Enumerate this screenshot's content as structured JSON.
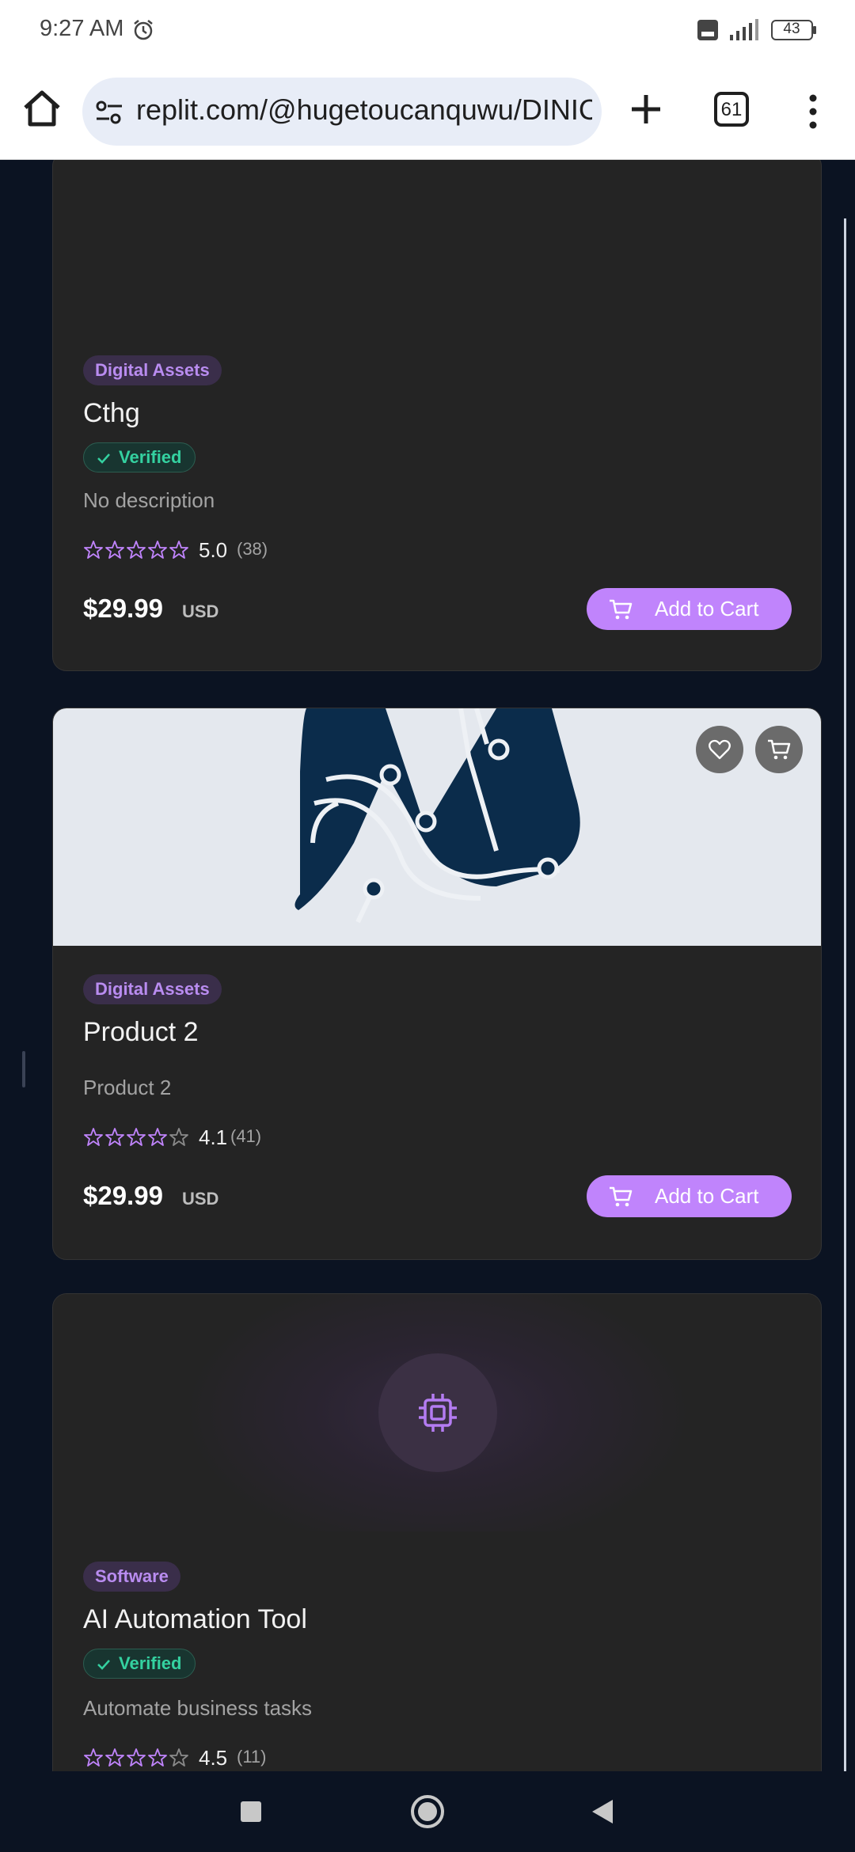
{
  "status_bar": {
    "time": "9:27 AM",
    "battery": "43"
  },
  "browser": {
    "url": "replit.com/@hugetoucanquwu/DINIC",
    "tab_count": "61"
  },
  "cards": [
    {
      "badge": "Digital Assets",
      "title": "Cthg",
      "verified": "Verified",
      "description": "No description",
      "rating": "5.0",
      "reviews": "(38)",
      "stars_filled": 5,
      "price": "$29.99",
      "currency": "USD",
      "cart_label": "Add to Cart"
    },
    {
      "badge": "Digital Assets",
      "title": "Product 2",
      "description": "Product 2",
      "rating": "4.1",
      "reviews": "(41)",
      "stars_filled": 4,
      "price": "$29.99",
      "currency": "USD",
      "cart_label": "Add to Cart"
    },
    {
      "badge": "Software",
      "title": "AI Automation Tool",
      "verified": "Verified",
      "description": "Automate business tasks",
      "rating": "4.5",
      "reviews": "(11)",
      "stars_filled": 4
    }
  ],
  "icons": {
    "status": [
      "alarm-icon",
      "volte-icon",
      "signal-icon",
      "battery-icon"
    ],
    "browser": [
      "home-icon",
      "site-settings-icon",
      "plus-icon",
      "tab-switcher-icon",
      "menu-dots-icon"
    ],
    "cards": [
      "star-icon",
      "cart-icon",
      "heart-icon",
      "check-icon",
      "cpu-chip-icon"
    ],
    "nav": [
      "recents-icon",
      "home-circle-icon",
      "back-triangle-icon"
    ]
  },
  "colors": {
    "accent": "#c084fc",
    "verified": "#34d1a0",
    "card_bg": "#242424",
    "page_bg": "#0b1322"
  }
}
